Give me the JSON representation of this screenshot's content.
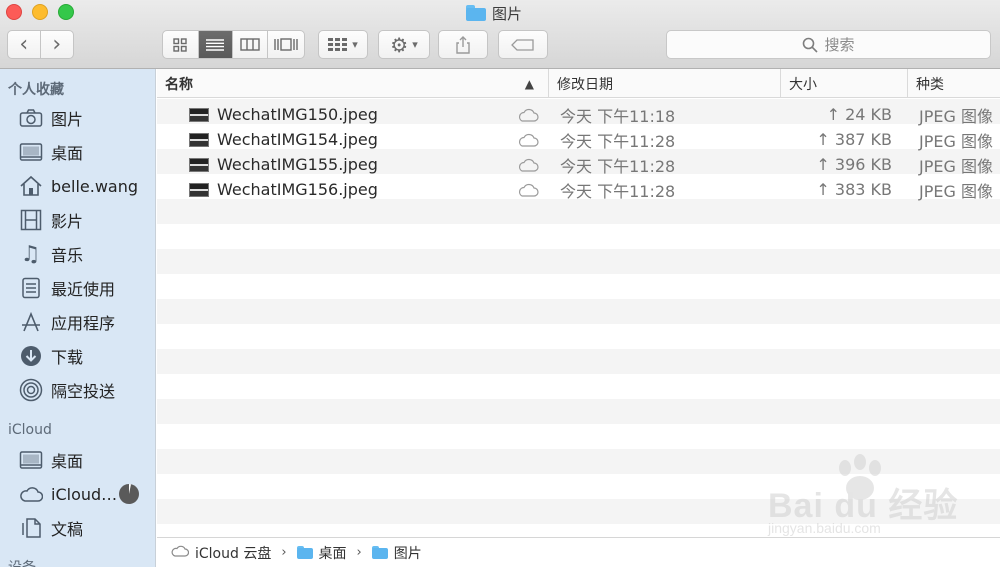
{
  "window": {
    "title": "图片"
  },
  "toolbar": {
    "back_glyph": "‹",
    "forward_glyph": "›",
    "search_placeholder": "搜索"
  },
  "sidebar": {
    "favorites_heading": "个人收藏",
    "favorites": [
      {
        "label": "图片",
        "icon": "camera-icon"
      },
      {
        "label": "桌面",
        "icon": "desktop-icon"
      },
      {
        "label": "belle.wang",
        "icon": "home-icon"
      },
      {
        "label": "影片",
        "icon": "film-icon"
      },
      {
        "label": "音乐",
        "icon": "music-icon"
      },
      {
        "label": "最近使用",
        "icon": "recents-icon"
      },
      {
        "label": "应用程序",
        "icon": "applications-icon"
      },
      {
        "label": "下载",
        "icon": "download-icon"
      },
      {
        "label": "隔空投送",
        "icon": "airdrop-icon"
      }
    ],
    "icloud_heading": "iCloud",
    "icloud": [
      {
        "label": "桌面",
        "icon": "desktop-icon"
      },
      {
        "label": "iCloud…",
        "icon": "cloud-icon"
      },
      {
        "label": "文稿",
        "icon": "documents-icon"
      }
    ],
    "devices_heading": "设备"
  },
  "columns": {
    "name": "名称",
    "modified": "修改日期",
    "size": "大小",
    "kind": "种类"
  },
  "files": [
    {
      "name": "WechatIMG150.jpeg",
      "modified": "今天 下午11:18",
      "size": "↑ 24 KB",
      "kind": "JPEG 图像"
    },
    {
      "name": "WechatIMG154.jpeg",
      "modified": "今天 下午11:28",
      "size": "↑ 387 KB",
      "kind": "JPEG 图像"
    },
    {
      "name": "WechatIMG155.jpeg",
      "modified": "今天 下午11:28",
      "size": "↑ 396 KB",
      "kind": "JPEG 图像"
    },
    {
      "name": "WechatIMG156.jpeg",
      "modified": "今天 下午11:28",
      "size": "↑ 383 KB",
      "kind": "JPEG 图像"
    }
  ],
  "pathbar": {
    "root": "iCloud 云盘",
    "folder1": "桌面",
    "folder2": "图片",
    "separator": "›"
  },
  "watermark": {
    "brand": "Bai du 经验",
    "url": "jingyan.baidu.com"
  },
  "colors": {
    "sidebar_bg": "#d9e7f5",
    "folder_blue": "#5bb5ef",
    "stripe": "#f4f4f4"
  }
}
